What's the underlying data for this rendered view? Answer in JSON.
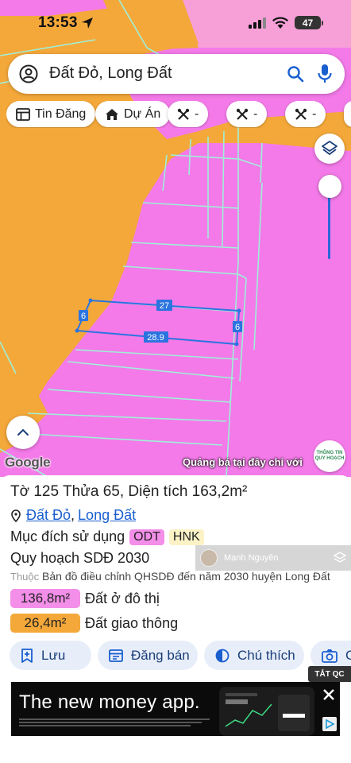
{
  "status_bar": {
    "time": "13:53",
    "battery": "47"
  },
  "search": {
    "query": "Đất Đỏ, Long Đất"
  },
  "chips": [
    {
      "label": "Tin Đăng",
      "icon": "news-icon"
    },
    {
      "label": "Dự Án",
      "icon": "house-icon"
    },
    {
      "label": "-",
      "icon": "tools-icon"
    },
    {
      "label": "-",
      "icon": "tools-icon"
    },
    {
      "label": "-",
      "icon": "tools-icon"
    }
  ],
  "map": {
    "colors": {
      "residential": "#f37ae8",
      "road": "#f4a83a",
      "parcel_line": "#9ff0d9",
      "selected_outline": "#2b74e0"
    },
    "parcel_dimensions": {
      "top": "27",
      "bottom": "28.9",
      "left": "6",
      "right": "6"
    },
    "attribution": "Google",
    "promo": "Quảng bá tại đây chỉ với",
    "info_badge": "THÔNG TIN QUY HOẠCH"
  },
  "parcel": {
    "title": "Tờ 125 Thửa 65, Diện tích 163,2m²",
    "location_commune": "Đất Đỏ",
    "location_district": "Long Đất",
    "location_sep": ",",
    "land_use_label": "Mục đích sử dụng",
    "land_use_tags": [
      "ODT",
      "HNK"
    ],
    "plan_label": "Quy hoạch SDĐ 2030",
    "belongs_label": "Thuộc",
    "belongs_value": "Bản đồ điều chỉnh QHSDĐ đến năm 2030 huyện Long Đất",
    "areas": [
      {
        "value": "136,8m²",
        "label": "Đất ở đô thị",
        "color": "#f38ee9"
      },
      {
        "value": "26,4m²",
        "label": "Đất giao thông",
        "color": "#f4a83a"
      }
    ]
  },
  "user_badge": {
    "name": "Mạnh Nguyên"
  },
  "actions": [
    {
      "label": "Lưu",
      "icon": "bookmark-add-icon"
    },
    {
      "label": "Đăng bán",
      "icon": "listing-icon"
    },
    {
      "label": "Chú thích",
      "icon": "contrast-icon"
    },
    {
      "label": "C",
      "icon": "camera-icon"
    }
  ],
  "ad": {
    "close_label": "TẮT QC",
    "headline": "The new money app."
  }
}
